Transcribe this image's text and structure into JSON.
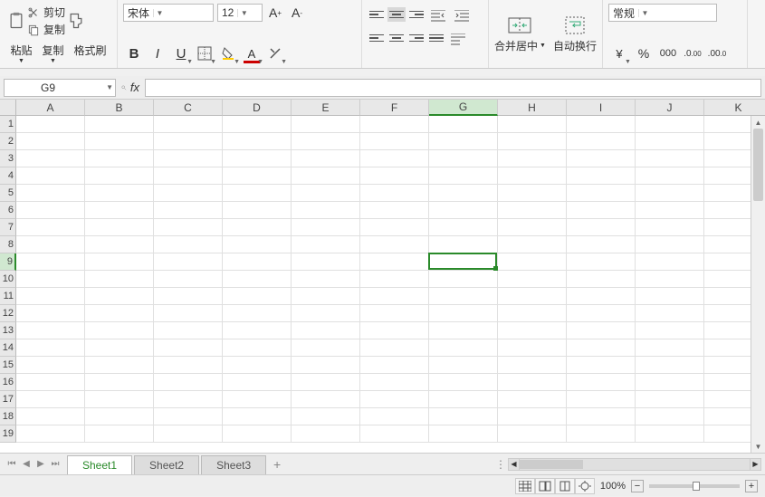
{
  "ribbon": {
    "clipboard": {
      "cut": "剪切",
      "copy": "复制",
      "paste": "粘贴",
      "format_painter": "格式刷"
    },
    "font": {
      "name": "宋体",
      "size": "12",
      "inc_label": "A⁺",
      "dec_label": "A⁻",
      "bold": "B",
      "italic": "I",
      "underline": "U"
    },
    "merge": {
      "merge_center": "合并居中",
      "wrap_text": "自动换行"
    },
    "number": {
      "format": "常规"
    }
  },
  "namebox": {
    "value": "G9"
  },
  "columns": [
    "A",
    "B",
    "C",
    "D",
    "E",
    "F",
    "G",
    "H",
    "I",
    "J",
    "K"
  ],
  "rows": [
    "1",
    "2",
    "3",
    "4",
    "5",
    "6",
    "7",
    "8",
    "9",
    "10",
    "11",
    "12",
    "13",
    "14",
    "15",
    "16",
    "17",
    "18",
    "19"
  ],
  "selected": {
    "col": "G",
    "row": "9"
  },
  "sheets": {
    "tabs": [
      "Sheet1",
      "Sheet2",
      "Sheet3"
    ],
    "active": 0
  },
  "status": {
    "zoom": "100%"
  }
}
